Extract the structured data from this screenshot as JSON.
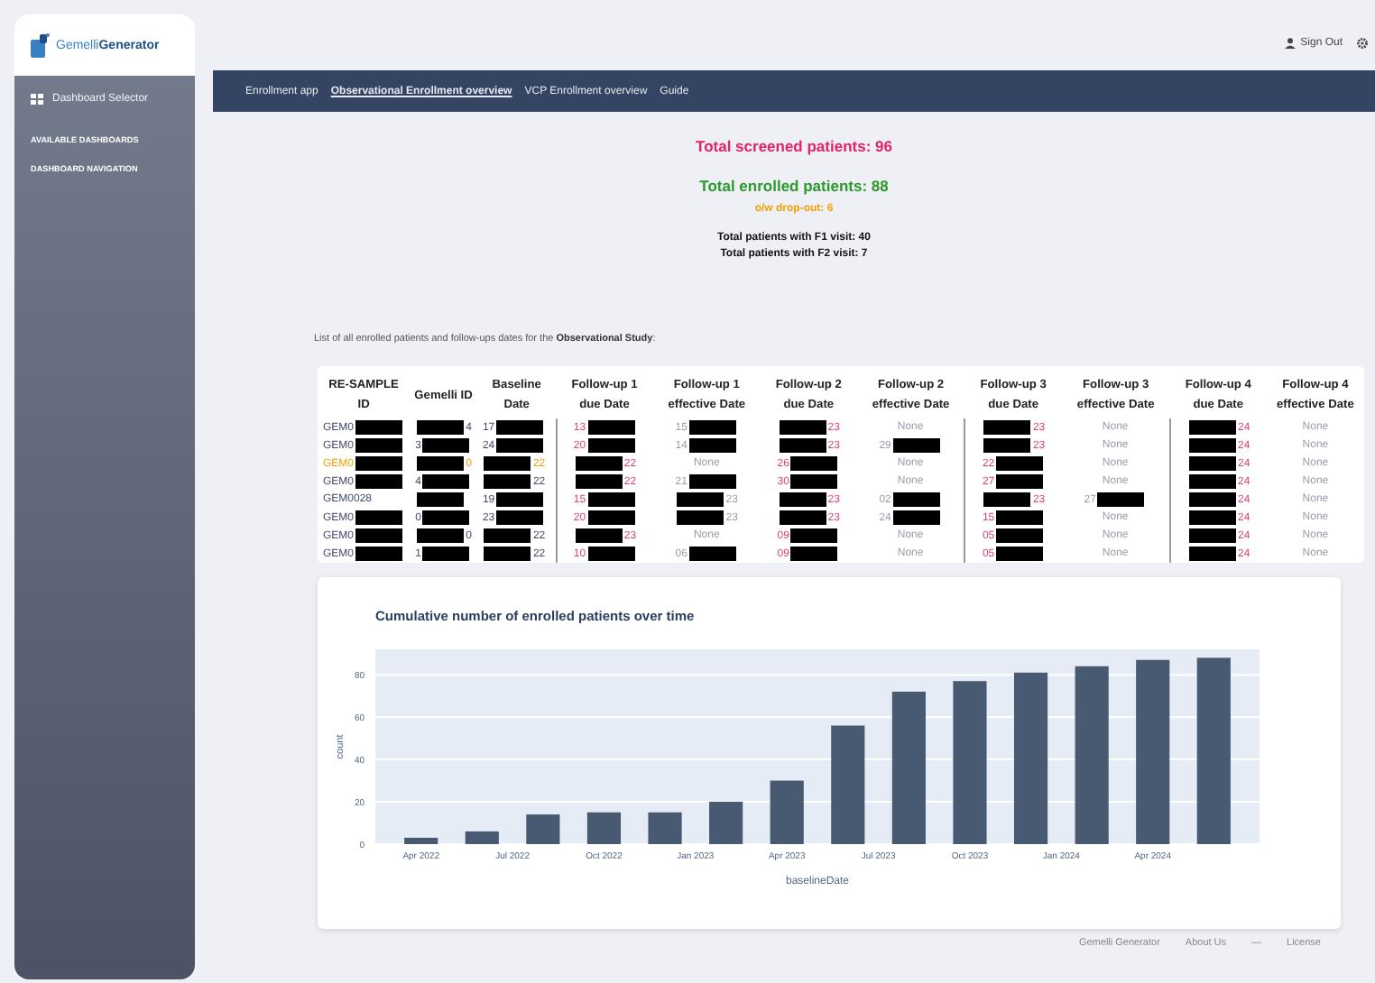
{
  "logo": {
    "name_light": "Gemelli",
    "name_bold": "Generator"
  },
  "sidebar": {
    "selector": "Dashboard Selector",
    "sections": [
      "AVAILABLE DASHBOARDS",
      "DASHBOARD NAVIGATION"
    ]
  },
  "topbar": {
    "sign_out": "Sign Out"
  },
  "nav": [
    {
      "label": "Enrollment app",
      "selected": false
    },
    {
      "label": "Observational Enrollment overview",
      "selected": true
    },
    {
      "label": "VCP Enrollment overview",
      "selected": false
    },
    {
      "label": "Guide",
      "selected": false
    }
  ],
  "stats": [
    {
      "text": "Total screened patients: 96",
      "kind": "screened"
    },
    {
      "text": "Total enrolled patients: 88",
      "kind": "enrolled"
    },
    {
      "text": "o/w drop-out: 6",
      "kind": "dropout"
    },
    {
      "text": "Total patients with F1 visit: 40",
      "kind": "visit"
    },
    {
      "text": "Total patients with F2 visit: 7",
      "kind": "visit"
    }
  ],
  "intro": "List of all enrolled patients and follow-ups dates for the **Observational Study**:",
  "table": {
    "columns": [
      {
        "label": "RE-SAMPLE ID",
        "kind": "id"
      },
      {
        "label": "Gemelli ID",
        "kind": "id"
      },
      {
        "label": "Baseline Date",
        "kind": "id"
      },
      {
        "label": "Follow-up 1 due Date",
        "kind": "due"
      },
      {
        "label": "Follow-up 1 effective Date",
        "kind": "effective"
      },
      {
        "label": "Follow-up 2 due Date",
        "kind": "due"
      },
      {
        "label": "Follow-up 2 effective Date",
        "kind": "effective"
      },
      {
        "label": "Follow-up 3 due Date",
        "kind": "due"
      },
      {
        "label": "Follow-up 3 effective Date",
        "kind": "effective"
      },
      {
        "label": "Follow-up 4 due Date",
        "kind": "due"
      },
      {
        "label": "Follow-up 4 effective Date",
        "kind": "effective"
      }
    ],
    "rows": [
      {
        "highlighted": false,
        "cells": [
          {
            "text": "GEM0",
            "kind": "masked_after"
          },
          {
            "text": "4",
            "kind": "masked_before"
          },
          {
            "text": "17",
            "kind": "masked_after"
          },
          {
            "text": "13",
            "kind": "masked_after"
          },
          {
            "text": "15",
            "kind": "masked_after"
          },
          {
            "text": "23",
            "kind": "masked_before"
          },
          {
            "text": "None",
            "kind": "plain"
          },
          {
            "text": "23",
            "kind": "masked_before"
          },
          {
            "text": "None",
            "kind": "plain"
          },
          {
            "text": "24",
            "kind": "masked_before"
          },
          {
            "text": "None",
            "kind": "plain"
          }
        ]
      },
      {
        "highlighted": false,
        "cells": [
          {
            "text": "GEM0",
            "kind": "masked_after"
          },
          {
            "text": "3",
            "kind": "masked_after"
          },
          {
            "text": "24",
            "kind": "masked_after"
          },
          {
            "text": "20",
            "kind": "masked_after"
          },
          {
            "text": "14",
            "kind": "masked_after"
          },
          {
            "text": "23",
            "kind": "masked_before"
          },
          {
            "text": "29",
            "kind": "masked_after"
          },
          {
            "text": "23",
            "kind": "masked_before"
          },
          {
            "text": "None",
            "kind": "plain"
          },
          {
            "text": "24",
            "kind": "masked_before"
          },
          {
            "text": "None",
            "kind": "plain"
          }
        ]
      },
      {
        "highlighted": true,
        "cells": [
          {
            "text": "GEM0",
            "kind": "masked_after"
          },
          {
            "text": "0",
            "kind": "masked_before"
          },
          {
            "text": "22",
            "kind": "masked_before"
          },
          {
            "text": "22",
            "kind": "masked_before"
          },
          {
            "text": "None",
            "kind": "plain"
          },
          {
            "text": "26",
            "kind": "masked_after"
          },
          {
            "text": "None",
            "kind": "plain"
          },
          {
            "text": "22",
            "kind": "masked_after"
          },
          {
            "text": "None",
            "kind": "plain"
          },
          {
            "text": "24",
            "kind": "masked_before"
          },
          {
            "text": "None",
            "kind": "plain"
          }
        ]
      },
      {
        "highlighted": false,
        "cells": [
          {
            "text": "GEM0",
            "kind": "masked_after"
          },
          {
            "text": "4",
            "kind": "masked_after"
          },
          {
            "text": "22",
            "kind": "masked_before"
          },
          {
            "text": "22",
            "kind": "masked_before"
          },
          {
            "text": "21",
            "kind": "masked_after"
          },
          {
            "text": "30",
            "kind": "masked_after"
          },
          {
            "text": "None",
            "kind": "plain"
          },
          {
            "text": "27",
            "kind": "masked_after"
          },
          {
            "text": "None",
            "kind": "plain"
          },
          {
            "text": "24",
            "kind": "masked_before"
          },
          {
            "text": "None",
            "kind": "plain"
          }
        ]
      },
      {
        "highlighted": false,
        "cells": [
          {
            "text": "GEM0028",
            "kind": "plain"
          },
          {
            "kind": "masked"
          },
          {
            "text": "19",
            "kind": "masked_after"
          },
          {
            "text": "15",
            "kind": "masked_after"
          },
          {
            "text": "23",
            "kind": "masked_before"
          },
          {
            "text": "23",
            "kind": "masked_before"
          },
          {
            "text": "02",
            "kind": "masked_after"
          },
          {
            "text": "23",
            "kind": "masked_before"
          },
          {
            "text": "27",
            "kind": "masked_after"
          },
          {
            "text": "24",
            "kind": "masked_before"
          },
          {
            "text": "None",
            "kind": "plain"
          }
        ]
      },
      {
        "highlighted": false,
        "cells": [
          {
            "text": "GEM0",
            "kind": "masked_after"
          },
          {
            "text": "0",
            "kind": "masked_after"
          },
          {
            "text": "23",
            "kind": "masked_after"
          },
          {
            "text": "20",
            "kind": "masked_after"
          },
          {
            "text": "23",
            "kind": "masked_before"
          },
          {
            "text": "23",
            "kind": "masked_before"
          },
          {
            "text": "24",
            "kind": "masked_after"
          },
          {
            "text": "15",
            "kind": "masked_after"
          },
          {
            "text": "None",
            "kind": "plain"
          },
          {
            "text": "24",
            "kind": "masked_before"
          },
          {
            "text": "None",
            "kind": "plain"
          }
        ]
      },
      {
        "highlighted": false,
        "cells": [
          {
            "text": "GEM0",
            "kind": "masked_after"
          },
          {
            "text": "0",
            "kind": "masked_before"
          },
          {
            "text": "22",
            "kind": "masked_before"
          },
          {
            "text": "23",
            "kind": "masked_before"
          },
          {
            "text": "None",
            "kind": "plain"
          },
          {
            "text": "09",
            "kind": "masked_after"
          },
          {
            "text": "None",
            "kind": "plain"
          },
          {
            "text": "05",
            "kind": "masked_after"
          },
          {
            "text": "None",
            "kind": "plain"
          },
          {
            "text": "24",
            "kind": "masked_before"
          },
          {
            "text": "None",
            "kind": "plain"
          }
        ]
      },
      {
        "highlighted": false,
        "cells": [
          {
            "text": "GEM0",
            "kind": "masked_after"
          },
          {
            "text": "1",
            "kind": "masked_after"
          },
          {
            "text": "22",
            "kind": "masked_before"
          },
          {
            "text": "10",
            "kind": "masked_after"
          },
          {
            "text": "06",
            "kind": "masked_after"
          },
          {
            "text": "09",
            "kind": "masked_after"
          },
          {
            "text": "None",
            "kind": "plain"
          },
          {
            "text": "05",
            "kind": "masked_after"
          },
          {
            "text": "None",
            "kind": "plain"
          },
          {
            "text": "24",
            "kind": "masked_before"
          },
          {
            "text": "None",
            "kind": "plain"
          }
        ]
      }
    ]
  },
  "chart": {
    "chart_data": {
      "type": "bar",
      "title": "Cumulative number of enrolled patients over time",
      "xlabel": "baselineDate",
      "ylabel": "count",
      "categories": [
        "Apr 2022",
        null,
        null,
        "Jul 2022",
        null,
        null,
        "Oct 2022",
        null,
        null,
        "Jan 2023",
        null,
        null,
        "Apr 2023",
        null,
        null,
        "Jul 2023",
        null,
        null,
        "Oct 2023",
        null,
        null,
        "Jan 2024",
        null,
        null,
        "Apr 2024",
        null,
        null
      ],
      "values": [
        3,
        null,
        6,
        null,
        14,
        null,
        15,
        null,
        15,
        null,
        20,
        null,
        30,
        null,
        56,
        null,
        72,
        null,
        77,
        null,
        81,
        null,
        84,
        null,
        87,
        null,
        88
      ],
      "ylim": [
        0,
        92
      ],
      "grid": true,
      "yticks": [
        0,
        20,
        40,
        60,
        80
      ]
    }
  },
  "footer": {
    "links": [
      "Gemelli Generator",
      "About Us",
      "License"
    ],
    "separator": "—"
  }
}
